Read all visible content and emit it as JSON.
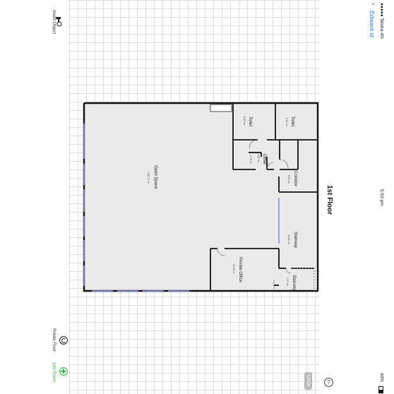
{
  "status_bar": {
    "carrier": "●●●●● Telstra  4G",
    "time": "5:53 pm",
    "battery": "40%"
  },
  "nav": {
    "back_label": "Edward st"
  },
  "floor_title": "1st Floor",
  "toolbar": {
    "insert_object": "Insert Object",
    "rotate_floor": "Rotate Floor",
    "add_room": "Add Room",
    "undo": "Undo"
  },
  "rooms": {
    "open_space": {
      "name": "Open Space",
      "area": "140.71 m²"
    },
    "toilet_a": {
      "name": "Toilet",
      "area": "6.89 m²"
    },
    "toilet_b": {
      "name": "Toilet",
      "area": "6.61 m²"
    },
    "other": {
      "name": "Other",
      "area": "2.59 m²"
    },
    "other_small": {
      "area": "2.70 m²"
    },
    "corridor": {
      "name": "Corridor",
      "area": "5.51 m²"
    },
    "stairway": {
      "name": "Stairway",
      "area": "16.89 m²"
    },
    "private_office": {
      "name": "Private Office",
      "area": "11.93 m²"
    },
    "balcony": {
      "name": "Balcony",
      "area": "5.27 m²"
    }
  },
  "colors": {
    "accent_blue": "#1f7bd9",
    "add_green": "#3bb54a",
    "wall": "#111111",
    "room_fill": "#eaeaea",
    "window": "#8a8fe8"
  }
}
